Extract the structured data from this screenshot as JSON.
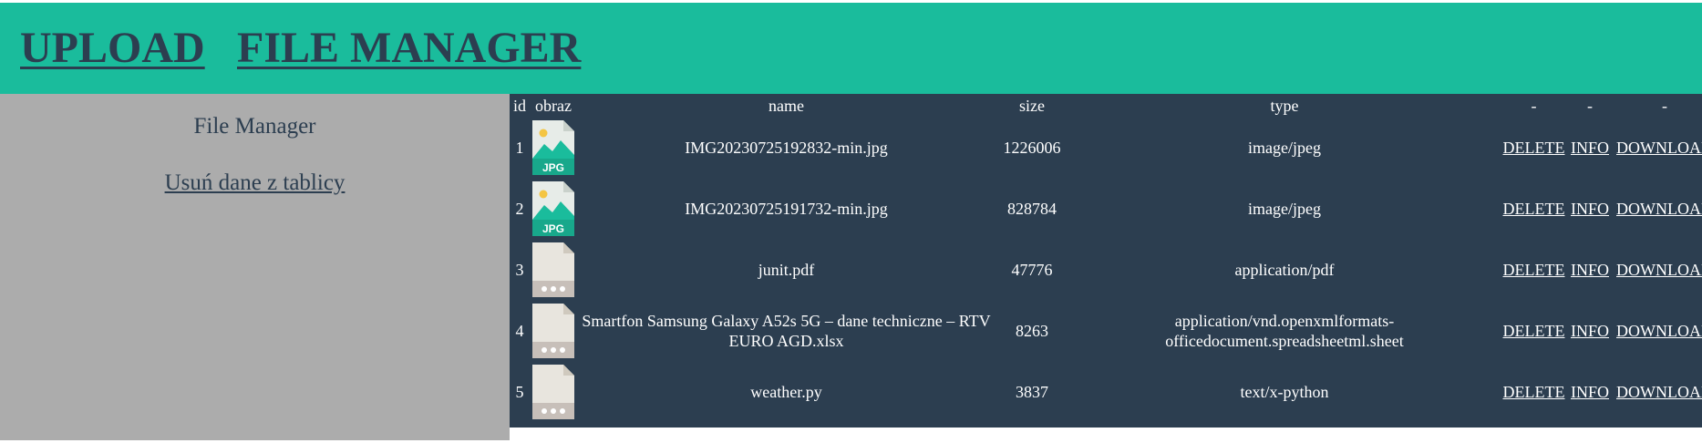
{
  "nav": {
    "upload_label": "UPLOAD",
    "file_manager_label": "FILE MANAGER"
  },
  "sidebar": {
    "title": "File Manager",
    "clear_link": "Usuń dane z tablicy"
  },
  "table": {
    "headers": {
      "id": "id",
      "image": "obraz",
      "name": "name",
      "size": "size",
      "type": "type",
      "action1": "-",
      "action2": "-",
      "action3": "-"
    },
    "actions": {
      "delete": "DELETE",
      "info": "INFO",
      "download": "DOWNLOAD"
    },
    "rows": [
      {
        "id": "1",
        "icon": "jpg-file-icon",
        "icon_label": "JPG",
        "name": "IMG20230725192832-min.jpg",
        "size": "1226006",
        "type": "image/jpeg"
      },
      {
        "id": "2",
        "icon": "jpg-file-icon",
        "icon_label": "JPG",
        "name": "IMG20230725191732-min.jpg",
        "size": "828784",
        "type": "image/jpeg"
      },
      {
        "id": "3",
        "icon": "generic-file-icon",
        "name": "junit.pdf",
        "size": "47776",
        "type": "application/pdf"
      },
      {
        "id": "4",
        "icon": "generic-file-icon",
        "name": "Smartfon Samsung Galaxy A52s 5G – dane techniczne – RTV EURO AGD.xlsx",
        "size": "8263",
        "type": "application/vnd.openxmlformats-officedocument.spreadsheetml.sheet"
      },
      {
        "id": "5",
        "icon": "generic-file-icon",
        "name": "weather.py",
        "size": "3837",
        "type": "text/x-python"
      }
    ]
  },
  "colors": {
    "header_bg": "#1abc9c",
    "nav_text": "#2c3e50",
    "sidebar_bg": "#acacac",
    "table_bg": "#2c3e50",
    "table_text": "#ffffff"
  }
}
